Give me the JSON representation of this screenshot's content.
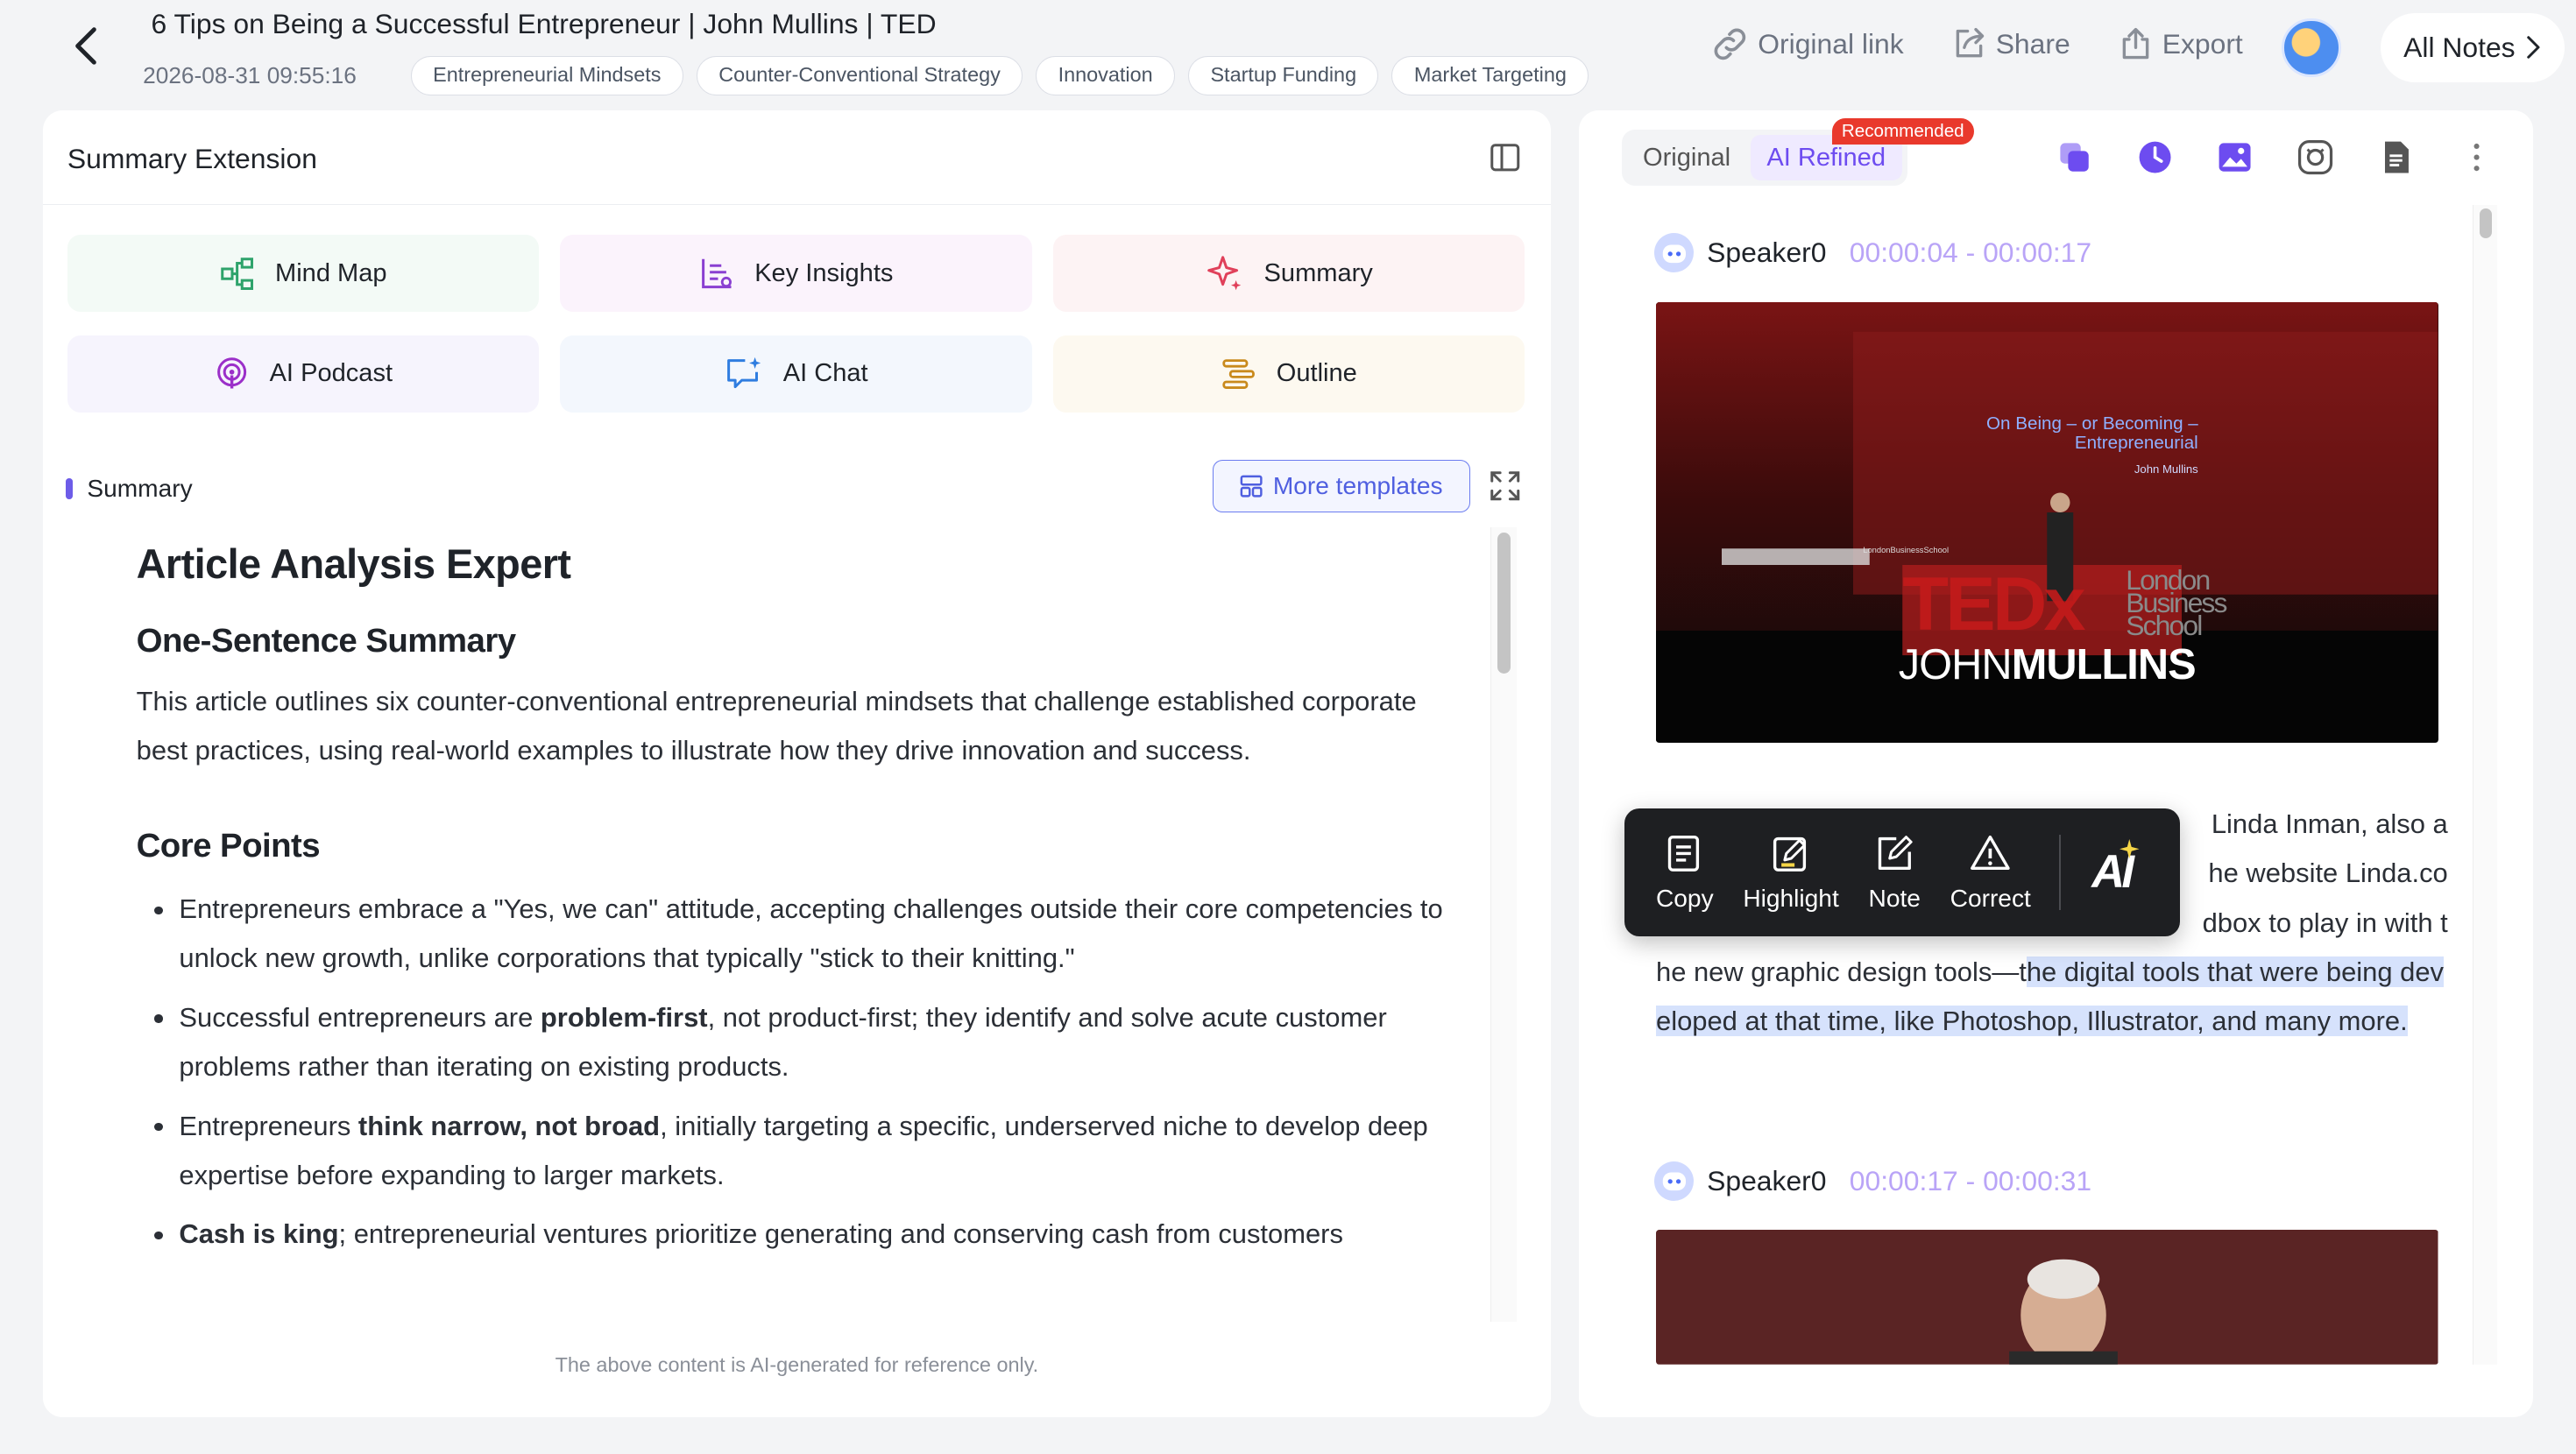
{
  "header": {
    "title": "6 Tips on Being a Successful Entrepreneur | John Mullins | TED",
    "datetime": "2026-08-31 09:55:16",
    "tags": [
      "Entrepreneurial Mindsets",
      "Counter-Conventional Strategy",
      "Innovation",
      "Startup Funding",
      "Market Targeting"
    ],
    "actions": {
      "original_link": "Original link",
      "share": "Share",
      "export": "Export"
    },
    "all_notes": "All Notes"
  },
  "left_panel": {
    "title": "Summary Extension",
    "templates": [
      {
        "label": "Mind Map",
        "icon": "mind-map-icon",
        "bg": "#f3faf6"
      },
      {
        "label": "Key Insights",
        "icon": "key-insights-icon",
        "bg": "#fbf3fc"
      },
      {
        "label": "Summary",
        "icon": "sparkle-icon",
        "bg": "#fdf3f4"
      },
      {
        "label": "AI Podcast",
        "icon": "podcast-icon",
        "bg": "#f6f4fd"
      },
      {
        "label": "AI Chat",
        "icon": "ai-chat-icon",
        "bg": "#f3f7fd"
      },
      {
        "label": "Outline",
        "icon": "outline-icon",
        "bg": "#fdf9f0"
      }
    ],
    "section_label": "Summary",
    "more_templates": "More templates",
    "content": {
      "h1": "Article Analysis Expert",
      "h2_summary": "One-Sentence Summary",
      "summary_text": "This article outlines six counter-conventional entrepreneurial mindsets that challenge established corporate best practices, using real-world examples to illustrate how they drive innovation and success.",
      "h2_points": "Core Points",
      "points": [
        {
          "pre": "Entrepreneurs embrace a \"Yes, we can\" attitude, accepting challenges outside their core competencies to unlock new growth, unlike corporations that typically \"stick to their knitting.\"",
          "bold": "",
          "post": ""
        },
        {
          "pre": "Successful entrepreneurs are ",
          "bold": "problem-first",
          "post": ", not product-first; they identify and solve acute customer problems rather than iterating on existing products."
        },
        {
          "pre": "Entrepreneurs ",
          "bold": "think narrow, not broad",
          "post": ", initially targeting a specific, underserved niche to develop deep expertise before expanding to larger markets."
        },
        {
          "pre": "",
          "bold": "Cash is king",
          "post": "; entrepreneurial ventures prioritize generating and conserving cash from customers"
        }
      ]
    },
    "disclaimer": "The above content is AI-generated for reference only."
  },
  "right_panel": {
    "tabs": [
      {
        "label": "Original",
        "active": false
      },
      {
        "label": "AI Refined",
        "active": true
      }
    ],
    "badge": "Recommended",
    "toolbar_icons": [
      "copy-stack-icon",
      "clock-icon",
      "image-icon",
      "screenshot-icon",
      "document-icon",
      "more-icon"
    ],
    "segments": [
      {
        "speaker": "Speaker0",
        "time": "00:00:04 - 00:00:17"
      },
      {
        "speaker": "Speaker0",
        "time": "00:00:17 - 00:00:31"
      }
    ],
    "video": {
      "slide_line1": "On Being – or Becoming –",
      "slide_line2": "Entrepreneurial",
      "slide_author": "John Mullins",
      "school_small": "LondonBusinessSchool",
      "ted_text": "TEDx",
      "school_line1": "London",
      "school_line2": "Business",
      "school_line3": "School",
      "name_light": "JOHN",
      "name_bold": "MULLINS"
    },
    "transcript_text": {
      "line1_tail": "Linda Inman, also a",
      "line2_tail": "he website Linda.co",
      "line3_tail": "dbox to play in with t",
      "plain": "he new graphic design tools—t",
      "highlighted": "he digital tools that were being developed at that time, like Photoshop, Illustrator, and many more."
    }
  },
  "float_toolbar": {
    "copy": "Copy",
    "highlight": "Highlight",
    "note": "Note",
    "correct": "Correct",
    "ai": "AI"
  },
  "colors": {
    "accent": "#6d4cf0",
    "link_blue": "#4f5fe0",
    "badge_red": "#e9392c",
    "highlight": "#d6e2fc"
  }
}
